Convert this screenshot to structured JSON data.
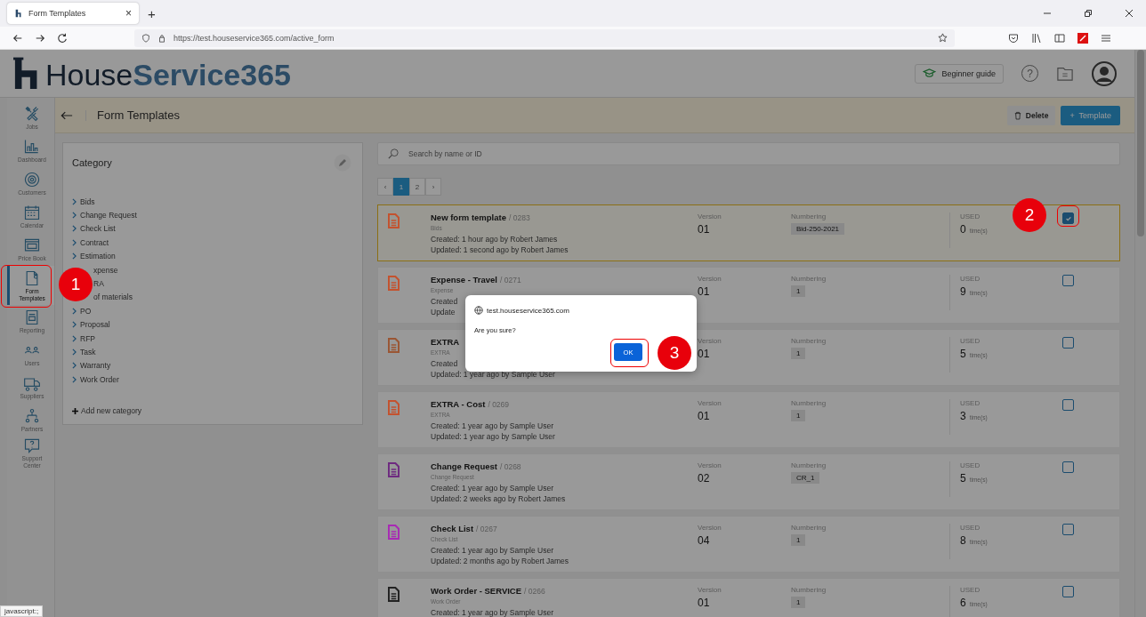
{
  "browser": {
    "tab": {
      "title": "Form Templates",
      "close": "×"
    },
    "new_tab": "+",
    "url": "https://test.houseservice365.com/active_form"
  },
  "header": {
    "logo_dark": "House",
    "logo_light": "Service365",
    "guide_button": "Beginner guide",
    "help": "?"
  },
  "sidebar": {
    "items": [
      {
        "label": "Jobs",
        "selected": false
      },
      {
        "label": "Dashboard",
        "selected": false
      },
      {
        "label": "Customers",
        "selected": false
      },
      {
        "label": "Calendar",
        "selected": false
      },
      {
        "label": "Price Book",
        "selected": false
      },
      {
        "label": "Form Templates",
        "selected": true
      },
      {
        "label": "Reporting",
        "selected": false
      },
      {
        "label": "Users",
        "selected": false
      },
      {
        "label": "Suppliers",
        "selected": false
      },
      {
        "label": "Partners",
        "selected": false
      },
      {
        "label": "Support Center",
        "selected": false
      }
    ]
  },
  "page": {
    "title": "Form Templates",
    "delete_button": "Delete",
    "add_button": {
      "icon": "+",
      "label": "Template"
    }
  },
  "category": {
    "title": "Category",
    "items": [
      {
        "label": "Bids",
        "covered": false
      },
      {
        "label": "Change Request",
        "covered": false
      },
      {
        "label": "Check List",
        "covered": false
      },
      {
        "label": "Contract",
        "covered": false
      },
      {
        "label": "Estimation",
        "covered": false
      },
      {
        "label": "xpense",
        "covered": true
      },
      {
        "label": "RA",
        "covered": true
      },
      {
        "label": "of materials",
        "covered": true
      },
      {
        "label": "PO",
        "covered": false
      },
      {
        "label": "Proposal",
        "covered": false
      },
      {
        "label": "RFP",
        "covered": false
      },
      {
        "label": "Task",
        "covered": false
      },
      {
        "label": "Warranty",
        "covered": false
      },
      {
        "label": "Work Order",
        "covered": false
      }
    ],
    "add": "Add new category"
  },
  "search": {
    "placeholder": "Search by name or ID"
  },
  "pagination": {
    "prev": "‹",
    "pages": [
      {
        "label": "1",
        "selected": true
      },
      {
        "label": "2",
        "selected": false
      }
    ],
    "next": "›"
  },
  "templates": [
    {
      "name": "New form template",
      "id": "/ 0283",
      "category": "Bids",
      "created": "Created: 1 hour ago by Robert James",
      "updated": "Updated: 1 second ago by Robert James",
      "version_label": "Version",
      "version": "01",
      "numbering_label": "Numbering",
      "numbering": "Bid-250-2021",
      "used_label": "USED",
      "used": "0",
      "used_unit": "time(s)",
      "checked": true,
      "selected": true,
      "color": "#c4522e"
    },
    {
      "name": "Expense - Travel",
      "id": "/ 0271",
      "category": "Expense",
      "created": "Created",
      "updated": "Update",
      "version_label": "Version",
      "version": "01",
      "numbering_label": "Numbering",
      "numbering": "1",
      "used_label": "USED",
      "used": "9",
      "used_unit": "time(s)",
      "checked": false,
      "selected": false,
      "color": "#c4522e"
    },
    {
      "name": "EXTRA",
      "category": "EXTRA",
      "created": "Created",
      "updated": "Updated: 1 year ago by Sample User",
      "version_label": "Version",
      "version": "01",
      "numbering_label": "Numbering",
      "numbering": "1",
      "used_label": "USED",
      "used": "5",
      "used_unit": "time(s)",
      "checked": false,
      "selected": false,
      "color": "#9a5634"
    },
    {
      "name": "EXTRA - Cost",
      "id": "/ 0269",
      "category": "EXTRA",
      "created": "Created: 1 year ago by Sample User",
      "updated": "Updated: 1 year ago by Sample User",
      "version_label": "Version",
      "version": "01",
      "numbering_label": "Numbering",
      "numbering": "1",
      "used_label": "USED",
      "used": "3",
      "used_unit": "time(s)",
      "checked": false,
      "selected": false,
      "color": "#c4522e"
    },
    {
      "name": "Change Request",
      "id": "/ 0268",
      "category": "Change Request",
      "created": "Created: 1 year ago by Sample User",
      "updated": "Updated: 2 weeks ago by Robert James",
      "version_label": "Version",
      "version": "02",
      "numbering_label": "Numbering",
      "numbering": "CR_1",
      "used_label": "USED",
      "used": "5",
      "used_unit": "time(s)",
      "checked": false,
      "selected": false,
      "color": "#6e2a80"
    },
    {
      "name": "Check List",
      "id": "/ 0267",
      "category": "Check List",
      "created": "Created: 1 year ago by Sample User",
      "updated": "Updated: 2 months ago by Robert James",
      "version_label": "Version",
      "version": "04",
      "numbering_label": "Numbering",
      "numbering": "1",
      "used_label": "USED",
      "used": "8",
      "used_unit": "time(s)",
      "checked": false,
      "selected": false,
      "color": "#a82ab4"
    },
    {
      "name": "Work Order - SERVICE",
      "id": "/ 0266",
      "category": "Work Order",
      "created": "Created: 1 year ago by Sample User",
      "version_label": "Version",
      "version": "01",
      "numbering_label": "Numbering",
      "numbering": "1",
      "used_label": "USED",
      "used": "6",
      "used_unit": "time(s)",
      "checked": false,
      "selected": false,
      "color": "#222222"
    }
  ],
  "dialog": {
    "origin": "test.houseservice365.com",
    "message": "Are you sure?",
    "ok": "OK"
  },
  "annotations": [
    {
      "number": "1"
    },
    {
      "number": "2"
    },
    {
      "number": "3"
    }
  ],
  "status_bar": "javascript:;"
}
